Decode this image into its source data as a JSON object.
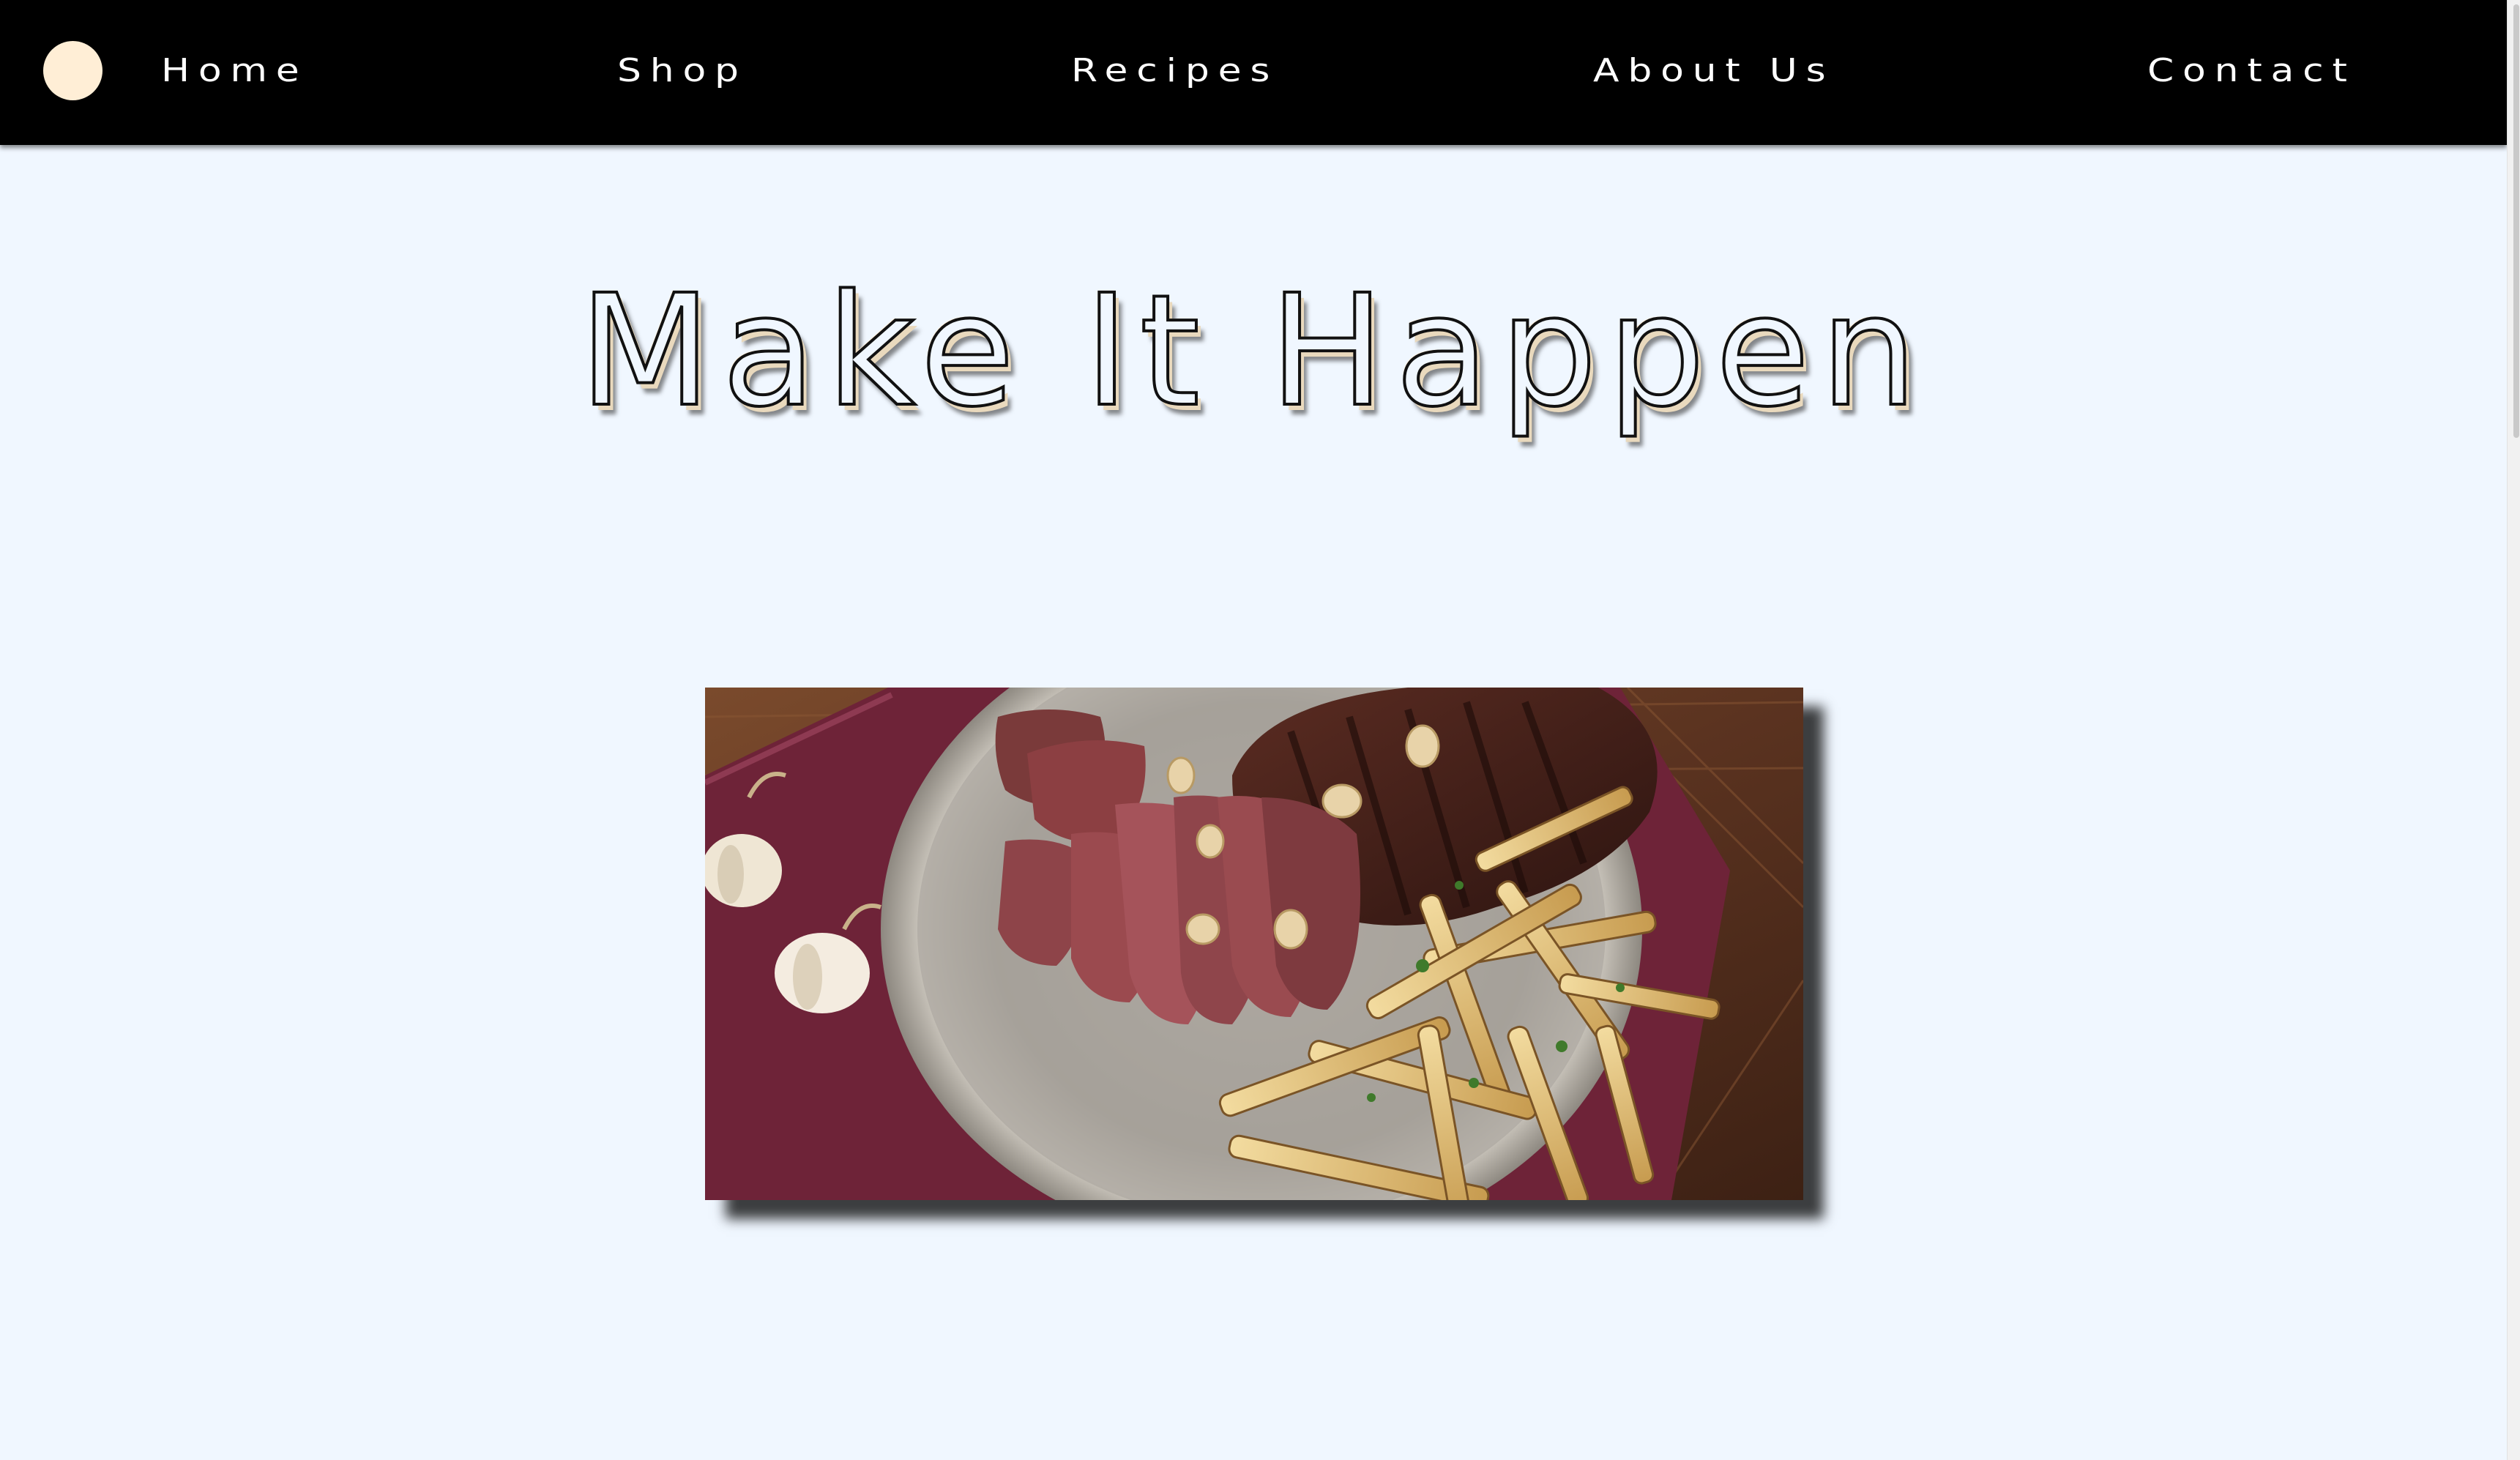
{
  "nav": {
    "items": [
      {
        "label": "Home"
      },
      {
        "label": "Shop"
      },
      {
        "label": "Recipes"
      },
      {
        "label": "About Us"
      },
      {
        "label": "Contact"
      }
    ]
  },
  "hero": {
    "title": "Make It Happen"
  },
  "colors": {
    "navbar_bg": "#000000",
    "page_bg": "#f0f7ff",
    "accent_cream": "#ffeed6",
    "nav_text": "#ffffff"
  }
}
